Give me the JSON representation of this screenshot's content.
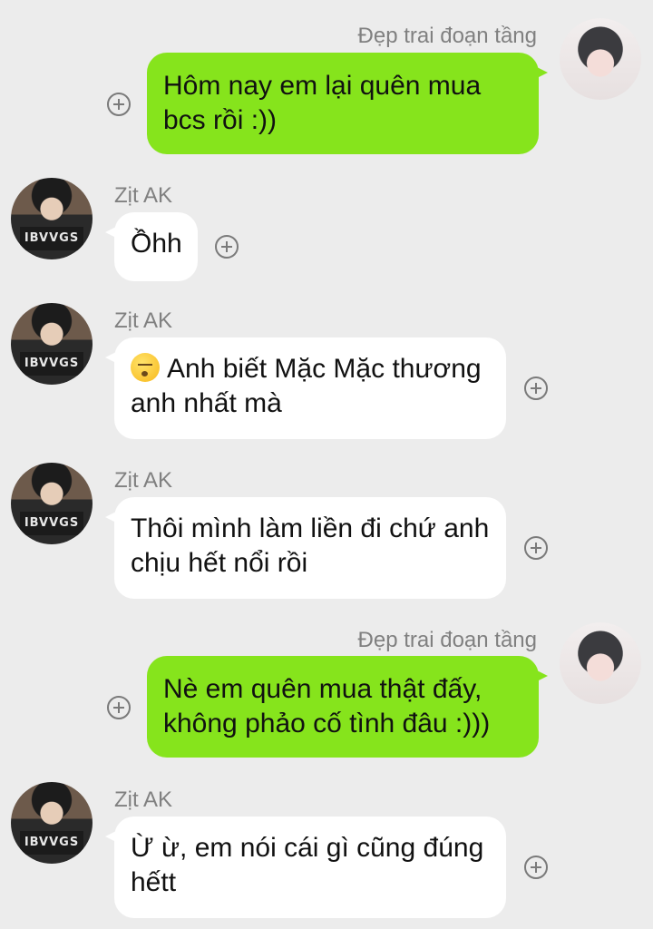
{
  "messages": [
    {
      "sender": "Đẹp trai đoạn tầng",
      "side": "right",
      "text": "Hôm nay em lại quên mua bcs rồi :))"
    },
    {
      "sender": "Zịt AK",
      "side": "left",
      "text": "Ồhh"
    },
    {
      "sender": "Zịt AK",
      "side": "left",
      "emoji": "kissing-face",
      "text": "Anh biết Mặc Mặc thương anh nhất mà"
    },
    {
      "sender": "Zịt AK",
      "side": "left",
      "text": "Thôi mình làm liền đi chứ anh chịu hết nổi rồi"
    },
    {
      "sender": "Đẹp trai đoạn tầng",
      "side": "right",
      "text": "Nè em quên mua thật đấy, không phảo cố tình đâu :)))"
    },
    {
      "sender": "Zịt AK",
      "side": "left",
      "text": "Ừ ừ, em nói cái gì cũng đúng hếtt"
    }
  ],
  "avatar_left_shirt_text": "IBVVGS",
  "colors": {
    "background": "#ececec",
    "outgoing": "#86e41c",
    "incoming": "#ffffff"
  }
}
